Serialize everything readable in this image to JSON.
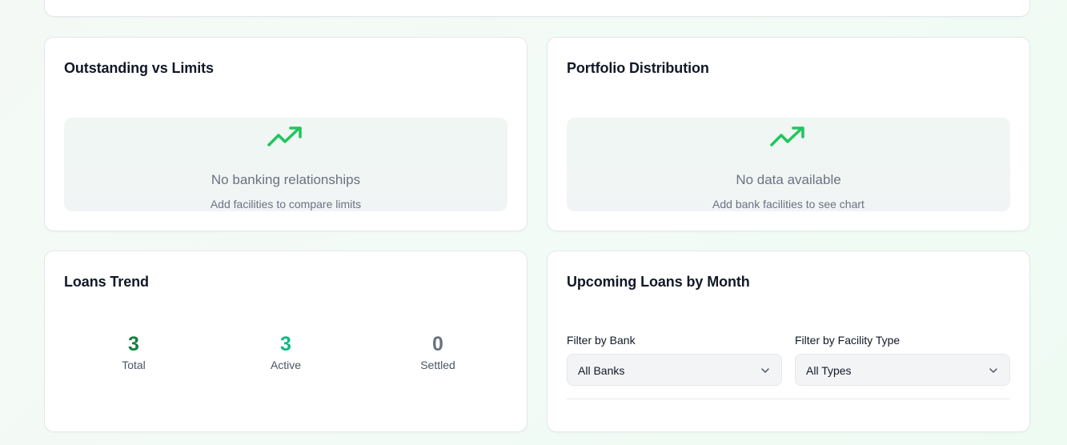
{
  "outstanding_card": {
    "title": "Outstanding vs Limits",
    "empty_title": "No banking relationships",
    "empty_subtitle": "Add facilities to compare limits",
    "icon": "trending-up-icon"
  },
  "portfolio_card": {
    "title": "Portfolio Distribution",
    "empty_title": "No data available",
    "empty_subtitle": "Add bank facilities to see chart",
    "icon": "trending-up-icon"
  },
  "loans_trend_card": {
    "title": "Loans Trend",
    "stats": [
      {
        "value": "3",
        "label": "Total",
        "color": "#15803d"
      },
      {
        "value": "3",
        "label": "Active",
        "color": "#10b981"
      },
      {
        "value": "0",
        "label": "Settled",
        "color": "#6b7280"
      }
    ]
  },
  "upcoming_card": {
    "title": "Upcoming Loans by Month",
    "filters": [
      {
        "label": "Filter by Bank",
        "value": "All Banks"
      },
      {
        "label": "Filter by Facility Type",
        "value": "All Types"
      }
    ]
  },
  "colors": {
    "accent": "#22c55e",
    "card_border": "#e5e7eb",
    "muted_text": "#6b7280"
  }
}
